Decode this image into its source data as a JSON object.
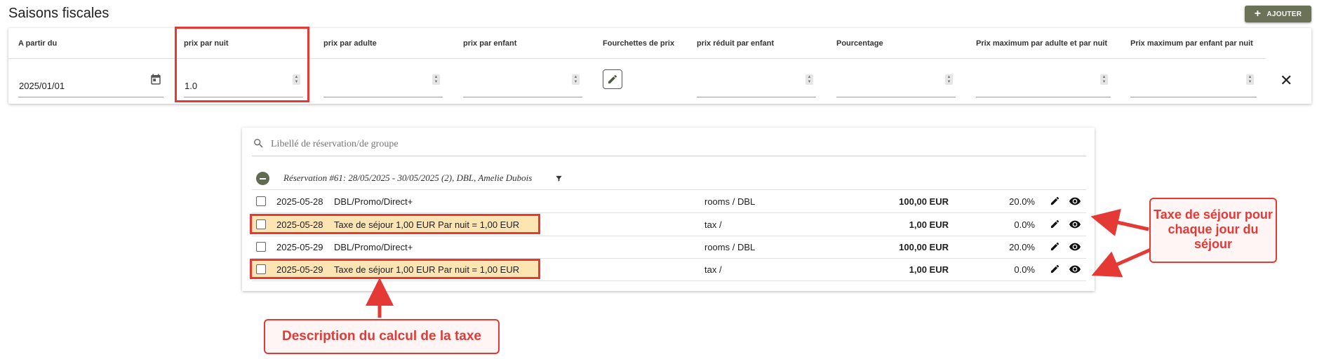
{
  "page": {
    "title": "Saisons fiscales",
    "add_button_label": "AJOUTER"
  },
  "season": {
    "columns": [
      "A partir du",
      "prix par nuit",
      "prix par adulte",
      "prix par enfant",
      "Fourchettes de prix",
      "prix réduit par enfant",
      "Pourcentage",
      "Prix maximum par adulte et par nuit",
      "Prix maximum par enfant par nuit"
    ],
    "start_date": "2025/01/01",
    "price_per_night": "1.0",
    "price_per_adult": "",
    "price_per_child": "",
    "reduced_price_per_child": "",
    "percentage": "",
    "max_price_adult_per_night": "",
    "max_price_child_per_night": ""
  },
  "bookings": {
    "search_placeholder": "Libellé de réservation/de groupe",
    "group_label": "Réservation #61: 28/05/2025 - 30/05/2025 (2), DBL, Amelie Dubois",
    "rows": [
      {
        "date": "2025-05-28",
        "description": "DBL/Promo/Direct+",
        "category": "rooms / DBL",
        "amount": "100,00 EUR",
        "percent": "20.0%"
      },
      {
        "date": "2025-05-28",
        "description": "Taxe de séjour 1,00 EUR Par nuit = 1,00 EUR",
        "category": "tax /",
        "amount": "1,00 EUR",
        "percent": "0.0%"
      },
      {
        "date": "2025-05-29",
        "description": "DBL/Promo/Direct+",
        "category": "rooms / DBL",
        "amount": "100,00 EUR",
        "percent": "20.0%"
      },
      {
        "date": "2025-05-29",
        "description": "Taxe de séjour 1,00 EUR Par nuit = 1,00 EUR",
        "category": "tax /",
        "amount": "1,00 EUR",
        "percent": "0.0%"
      }
    ]
  },
  "annotations": {
    "tax_each_day": "Taxe de séjour pour chaque jour du séjour",
    "tax_description": "Description du calcul de la taxe",
    "highlight_color": "#e53935",
    "highlight_fill": "#fde4b3"
  },
  "colors": {
    "accent": "#6b7257",
    "toggle": "#5f6b52"
  }
}
